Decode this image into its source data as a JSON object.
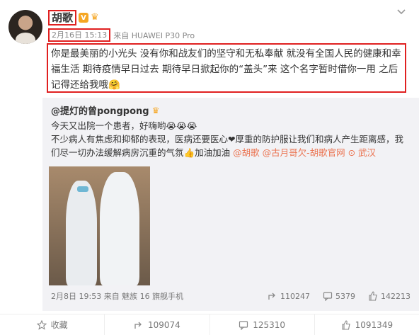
{
  "post": {
    "author": "胡歌",
    "verified_badge": "V",
    "time": "2月16日 15:13",
    "source": "来自 HUAWEI P30 Pro",
    "text": "你是最美丽的小光头 没有你和战友们的坚守和无私奉献 就没有全国人民的健康和幸福生活 期待疫情早日过去 期待早日掀起你的“盖头”来 这个名字暂时借你一用 之后记得还给我哦🤗"
  },
  "repost": {
    "author": "@提灯的曾pongpong",
    "line1": "今天又出院一个患者，好嗨哟😭😭😭",
    "line2": "不少病人有焦虑和抑郁的表现，医病还要医心❤厚重的防护服让我们和病人产生距离感，我们尽一切办法缓解病房沉重的气氛👍加油加油",
    "mention1": "@胡歌",
    "mention2": "@古月哥欠-胡歌官网",
    "location": "武汉",
    "meta": "2月8日 19:53 来自 魅族 16 旗舰手机",
    "reposts": "110247",
    "comments": "5379",
    "likes": "142213"
  },
  "actions": {
    "favorite": "收藏",
    "repost": "109074",
    "comment": "125310",
    "like": "1091349"
  },
  "colors": {
    "highlight": "#e02020",
    "link": "#eb7350",
    "badge": "#f5a623"
  }
}
